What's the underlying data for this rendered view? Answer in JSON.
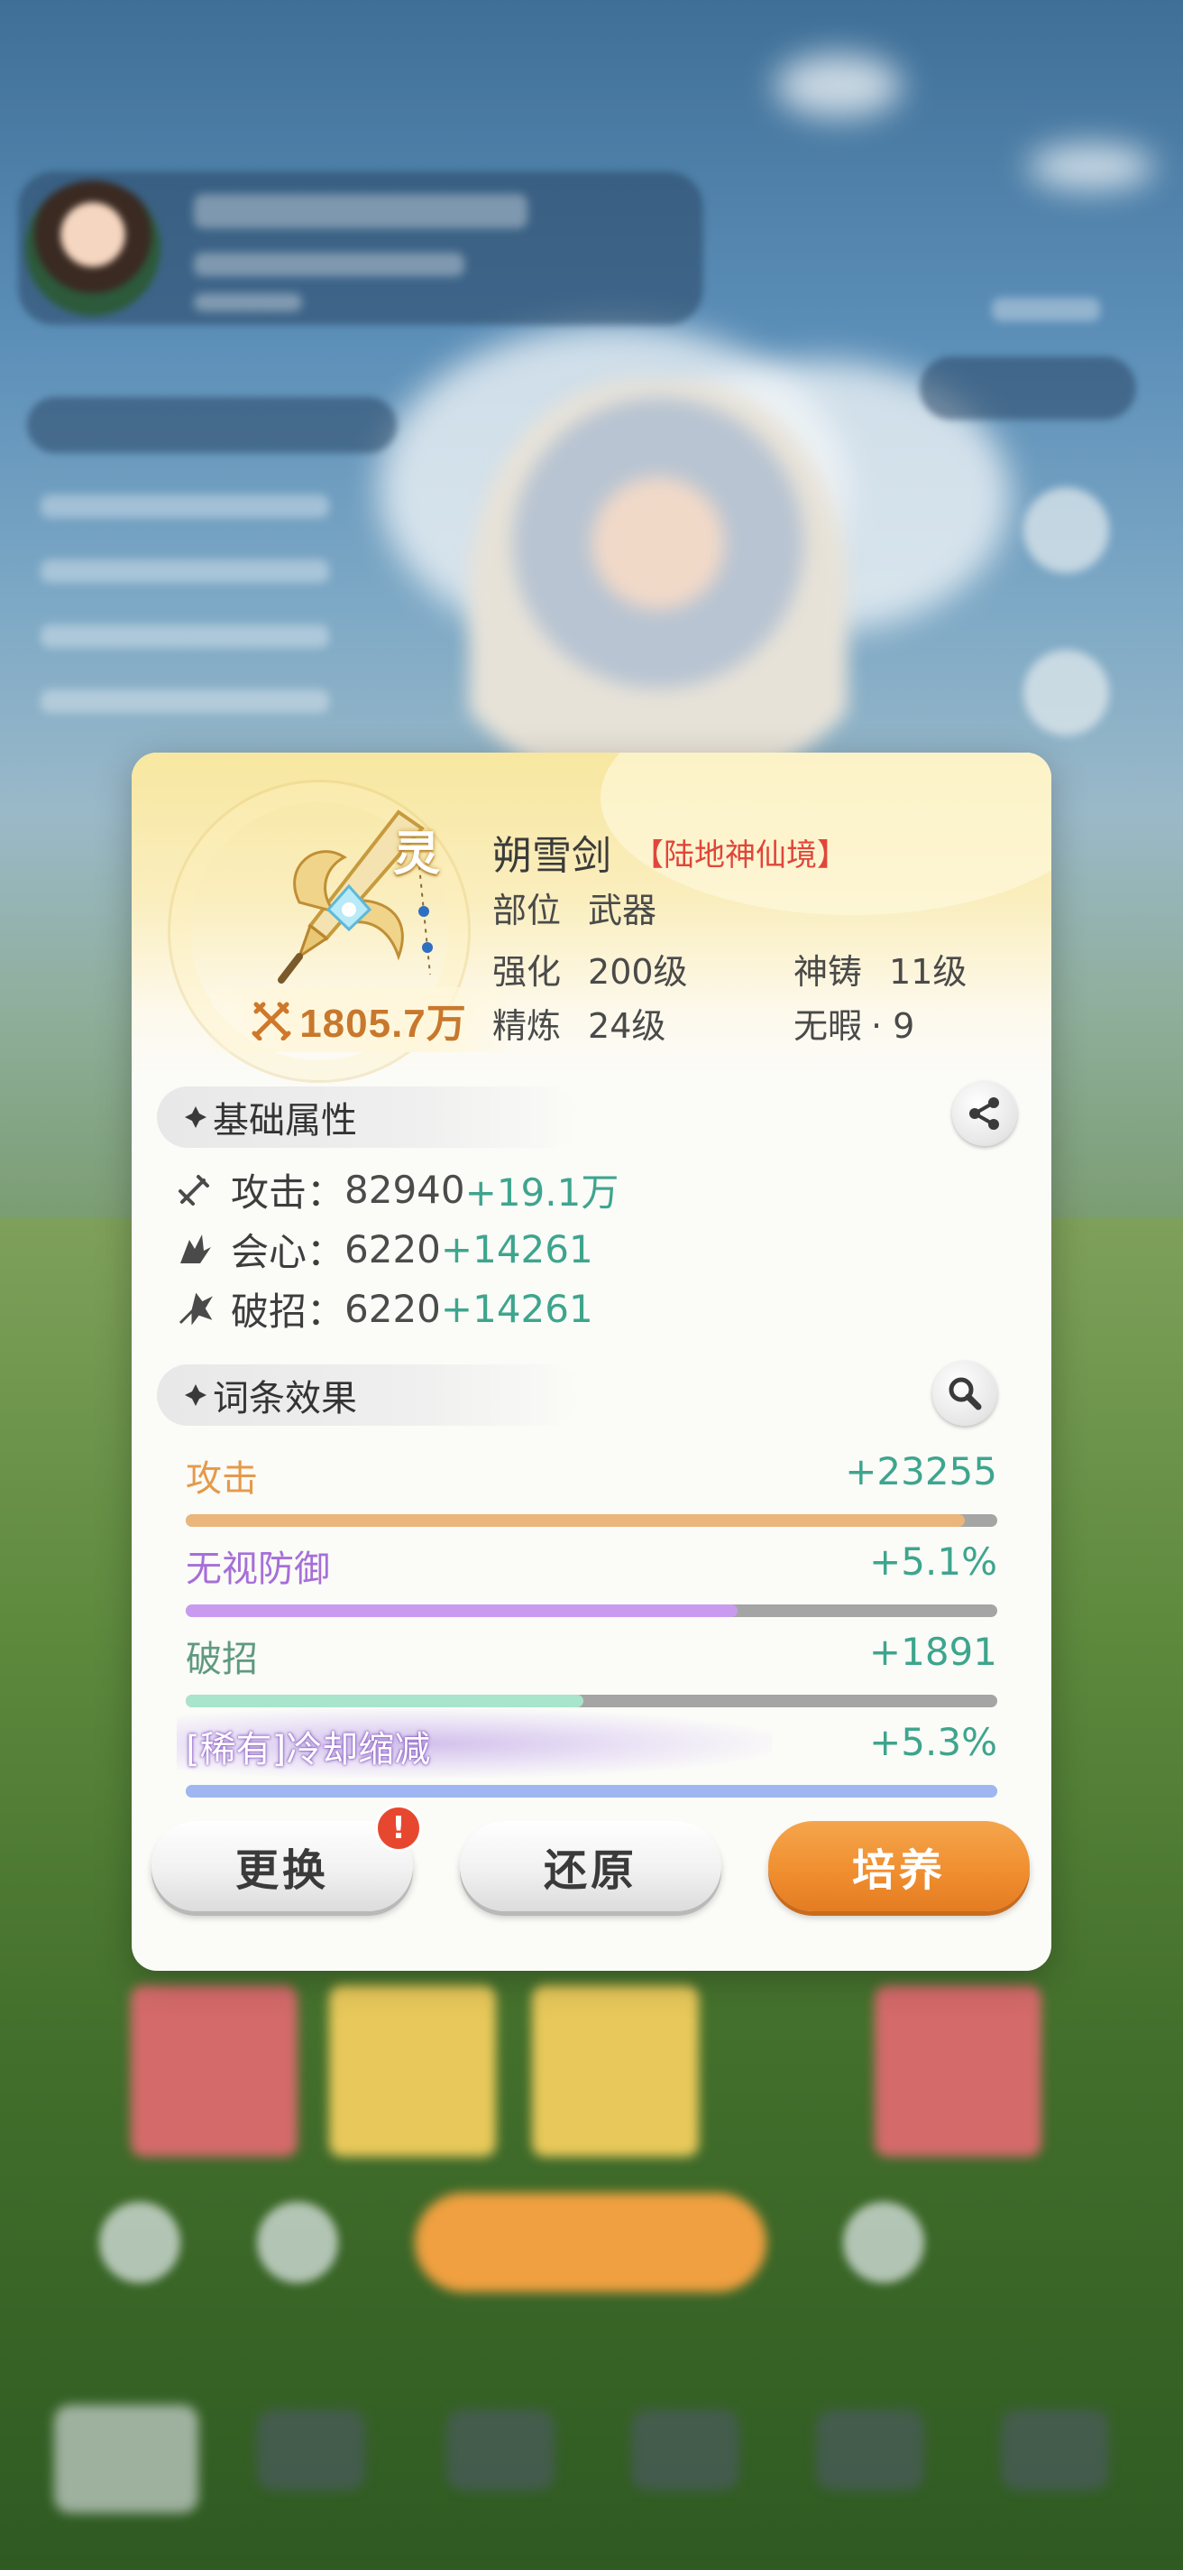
{
  "item": {
    "name": "朔雪剑",
    "realm": "【陆地神仙境】",
    "badge": "灵",
    "power": "1805.7万",
    "slot_label": "部位",
    "slot_value": "武器",
    "enhance_label": "强化",
    "enhance_value": "200级",
    "forge_label": "神铸",
    "forge_value": "11级",
    "refine_label": "精炼",
    "refine_value": "24级",
    "flawless_label": "无暇",
    "flawless_value": "· 9"
  },
  "base_section": {
    "title": "基础属性",
    "stats": [
      {
        "label": "攻击：",
        "base": "82940",
        "bonus": "+19.1万",
        "icon": "attack-icon"
      },
      {
        "label": "会心：",
        "base": "6220",
        "bonus": "+14261",
        "icon": "crit-icon"
      },
      {
        "label": "破招：",
        "base": "6220",
        "bonus": "+14261",
        "icon": "break-icon"
      }
    ]
  },
  "affix_section": {
    "title": "词条效果",
    "affixes": [
      {
        "name": "攻击",
        "value": "+23255",
        "fill": 0.96,
        "name_color": "#e59a4a",
        "bar_color": "#eab67c"
      },
      {
        "name": "无视防御",
        "value": "+5.1%",
        "fill": 0.68,
        "name_color": "#a66fd8",
        "bar_color": "#c99bf0"
      },
      {
        "name": "破招",
        "value": "+1891",
        "fill": 0.49,
        "name_color": "#5f9a7f",
        "bar_color": "#a9e4cc"
      },
      {
        "name": "[稀有]冷却缩减",
        "value": "+5.3%",
        "fill": 1.0,
        "name_color": "#ffffff",
        "bar_color": "#9fb6f2",
        "rare": true
      }
    ]
  },
  "buttons": {
    "replace": "更换",
    "restore": "还原",
    "cultivate": "培养",
    "alert": "!"
  },
  "colors": {
    "accent_orange": "#ef8d2e",
    "bonus_green": "#3ea58d",
    "realm_red": "#e0463a",
    "power_orange": "#c8782c"
  }
}
